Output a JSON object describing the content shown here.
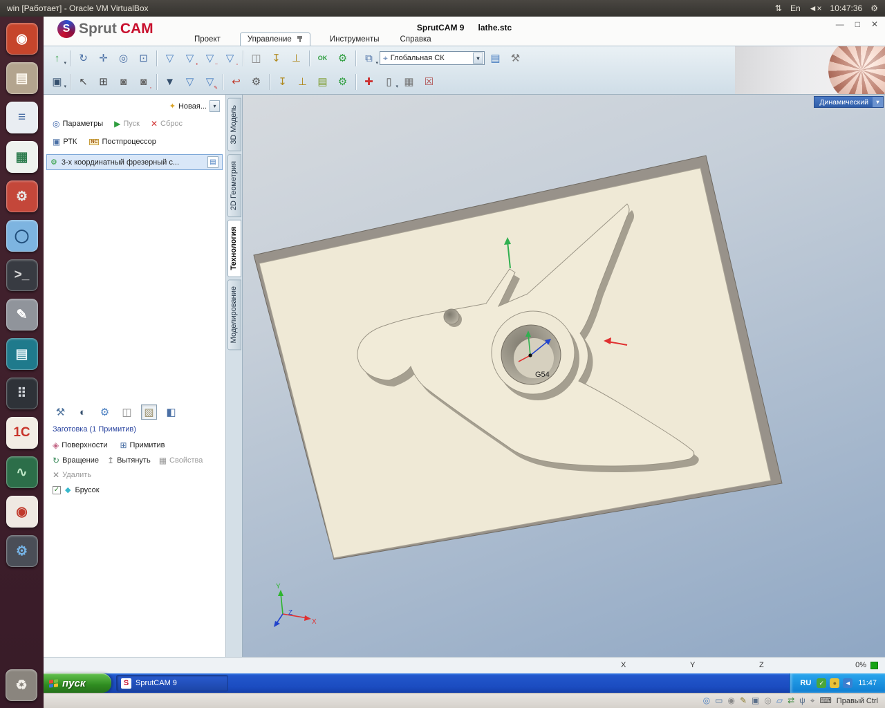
{
  "vbox": {
    "title": "win [Работает] - Oracle VM VirtualBox",
    "updown_icon": "⇅",
    "lang_indicator": "En",
    "mute_icon": "◄×",
    "clock": "10:47:36",
    "power_icon": "⚙",
    "host_key": "Правый Ctrl",
    "status_icons": [
      {
        "n": "zoom-status-icon",
        "g": "◎",
        "c": "#4a7fc1"
      },
      {
        "n": "screen-size-icon",
        "g": "▭",
        "c": "#4a6f9a"
      },
      {
        "n": "record-icon",
        "g": "◉",
        "c": "#888888"
      },
      {
        "n": "edit-icon",
        "g": "✎",
        "c": "#8a7a2a"
      },
      {
        "n": "hdd-icon",
        "g": "▣",
        "c": "#5a6f8a"
      },
      {
        "n": "cd-icon",
        "g": "◎",
        "c": "#888888"
      },
      {
        "n": "shared-folder-icon",
        "g": "▱",
        "c": "#4a7fc1"
      },
      {
        "n": "network-icon",
        "g": "⇄",
        "c": "#3c8a3c"
      },
      {
        "n": "usb-icon",
        "g": "ψ",
        "c": "#5a6f8a"
      },
      {
        "n": "mouse-integration-icon",
        "g": "⌖",
        "c": "#777777"
      },
      {
        "n": "keyboard-icon",
        "g": "⌨",
        "c": "#444444"
      }
    ]
  },
  "launcher": {
    "items": [
      {
        "n": "launcher-dash",
        "g": "◉",
        "bg": "#c6452c",
        "fg": "#ffffff"
      },
      {
        "n": "launcher-files",
        "g": "▤",
        "bg": "#b3a48e",
        "fg": "#fdf8ef"
      },
      {
        "n": "launcher-text-editor",
        "g": "≡",
        "bg": "#e9edf2",
        "fg": "#4a6fa5"
      },
      {
        "n": "launcher-spreadsheet",
        "g": "▦",
        "bg": "#eef2ee",
        "fg": "#2f7d4f"
      },
      {
        "n": "launcher-system-settings",
        "g": "⚙",
        "bg": "#c4473a",
        "fg": "#e8e8e8"
      },
      {
        "n": "launcher-browser",
        "g": "◯",
        "bg": "#7db4e0",
        "fg": "#1f4d7a"
      },
      {
        "n": "launcher-terminal",
        "g": ">_",
        "bg": "#383b42",
        "fg": "#d6d6d6"
      },
      {
        "n": "launcher-notes",
        "g": "✎",
        "bg": "#90949b",
        "fg": "#ffffff"
      },
      {
        "n": "launcher-docs",
        "g": "▤",
        "bg": "#1f7a8c",
        "fg": "#e2f2f6"
      },
      {
        "n": "launcher-calculator",
        "g": "⠿",
        "bg": "#2e3238",
        "fg": "#cfd3d8"
      },
      {
        "n": "launcher-1c",
        "g": "1С",
        "bg": "#f2ede4",
        "fg": "#c8342a"
      },
      {
        "n": "launcher-system-monitor",
        "g": "∿",
        "bg": "#2c6e49",
        "fg": "#bfe8c8"
      },
      {
        "n": "launcher-media",
        "g": "◉",
        "bg": "#efe9e2",
        "fg": "#c0392b"
      },
      {
        "n": "launcher-tweaks",
        "g": "⚙",
        "bg": "#4a4e57",
        "fg": "#76b5e8"
      }
    ],
    "trash": {
      "n": "launcher-trash",
      "g": "♻",
      "bg": "#8a857e",
      "fg": "#f2efe9"
    }
  },
  "app": {
    "logo_s": "S",
    "logo_sprut": "Sprut",
    "logo_cam": "CAM",
    "title": "SprutCAM 9",
    "file": "lathe.stc",
    "controls": {
      "minimize": "—",
      "restore": "□",
      "close": "✕"
    },
    "menus": [
      {
        "label": "Проект"
      },
      {
        "label": "Управление"
      },
      {
        "label": "Инструменты"
      },
      {
        "label": "Справка"
      }
    ]
  },
  "toolbar": {
    "cs_label": "Глобальная СК",
    "cs_icon": "⌖",
    "row1": [
      {
        "n": "open-model-button",
        "g": "↑",
        "c": "#2f9e3f",
        "dd": true
      },
      {
        "n": "sep"
      },
      {
        "n": "rotate-view-button",
        "g": "↻",
        "c": "#4a6fa5"
      },
      {
        "n": "pan-view-button",
        "g": "✛",
        "c": "#4a6fa5"
      },
      {
        "n": "zoom-view-button",
        "g": "◎",
        "c": "#4a6fa5"
      },
      {
        "n": "fit-view-button",
        "g": "⊡",
        "c": "#4a6fa5"
      },
      {
        "n": "sep"
      },
      {
        "n": "new-operation-button",
        "g": "▽",
        "c": "#4a7fc1"
      },
      {
        "n": "operation-point-button",
        "g": "▽",
        "c": "#4a7fc1",
        "b": "•"
      },
      {
        "n": "operation-curve-button",
        "g": "▽",
        "c": "#4a7fc1",
        "b": "~"
      },
      {
        "n": "operation-box-button",
        "g": "▽",
        "c": "#4a7fc1",
        "b": "▫"
      },
      {
        "n": "sep"
      },
      {
        "n": "stock-button",
        "g": "◫",
        "c": "#8a8a8a"
      },
      {
        "n": "tool-table-button",
        "g": "↧",
        "c": "#b08a20"
      },
      {
        "n": "tool-holder-button",
        "g": "⊥",
        "c": "#b08a20"
      },
      {
        "n": "sep"
      },
      {
        "n": "part-ok-button",
        "g": "OK",
        "c": "#2f9e3f"
      },
      {
        "n": "machine-setup-button",
        "g": "⚙",
        "c": "#2f9e3f"
      },
      {
        "n": "sep"
      },
      {
        "n": "layout-button",
        "g": "⧉",
        "c": "#4a6fa5",
        "dd": true
      },
      {
        "n": "cs-combo",
        "combo": true
      },
      {
        "n": "material-button",
        "g": "▤",
        "c": "#4a7fc1"
      },
      {
        "n": "hammer-button",
        "g": "⚒",
        "c": "#777777"
      }
    ],
    "row2": [
      {
        "n": "save-project-button",
        "g": "▣",
        "c": "#35506e",
        "dd": true
      },
      {
        "n": "sep"
      },
      {
        "n": "select-button",
        "g": "↖",
        "c": "#444444"
      },
      {
        "n": "box-select-button",
        "g": "⊞",
        "c": "#444444"
      },
      {
        "n": "capture-view-button",
        "g": "◙",
        "c": "#666666"
      },
      {
        "n": "capture-region-button",
        "g": "◙",
        "c": "#666666",
        "b": "▫"
      },
      {
        "n": "sep"
      },
      {
        "n": "funnel-active-button",
        "g": "▼",
        "c": "#35506e"
      },
      {
        "n": "funnel-button",
        "g": "▽",
        "c": "#4a7fc1"
      },
      {
        "n": "funnel-edit-button",
        "g": "▽",
        "c": "#4a7fc1",
        "b": "✎"
      },
      {
        "n": "sep"
      },
      {
        "n": "undo-button",
        "g": "↩",
        "c": "#c0392b"
      },
      {
        "n": "machine-gear-button",
        "g": "⚙",
        "c": "#555555"
      },
      {
        "n": "sep"
      },
      {
        "n": "spindle-button",
        "g": "↧",
        "c": "#b08a20"
      },
      {
        "n": "toolpath-button",
        "g": "⊥",
        "c": "#b08a20"
      },
      {
        "n": "gcode-button",
        "g": "▤",
        "c": "#7a9a2a"
      },
      {
        "n": "simulate-button",
        "g": "⚙",
        "c": "#2f9e3f"
      },
      {
        "n": "sep"
      },
      {
        "n": "transform-button",
        "g": "✚",
        "c": "#cc3333"
      },
      {
        "n": "new-doc-button",
        "g": "▯",
        "c": "#555555",
        "dd": true
      },
      {
        "n": "export-image-button",
        "g": "▦",
        "c": "#777777"
      },
      {
        "n": "delete-table-button",
        "g": "☒",
        "c": "#b05555"
      }
    ]
  },
  "panel": {
    "new_label": "Новая...",
    "new_icon": "✦",
    "params_label": "Параметры",
    "params_icon": "◎",
    "start_label": "Пуск",
    "start_icon": "▶",
    "reset_label": "Сброс",
    "reset_icon": "✕",
    "rtk_label": "РТК",
    "rtk_icon": "▣",
    "post_label": "Постпроцессор",
    "post_icon": "NC",
    "operation_label": "3-х координатный фрезерный с...",
    "operation_icon": "⚙",
    "operation_doc_icon": "▤",
    "workpiece_title": "Заготовка  (1 Примитив)",
    "tools": [
      {
        "n": "workpiece-machine-button",
        "g": "⚒",
        "c": "#4a6f9a"
      },
      {
        "n": "workpiece-shaded-button",
        "g": "◐",
        "c": "#35506e"
      },
      {
        "n": "workpiece-settings-button",
        "g": "⚙",
        "c": "#4a7fc1"
      },
      {
        "n": "workpiece-cylinder-button",
        "g": "◫",
        "c": "#8a8a8a"
      },
      {
        "n": "workpiece-box-button",
        "g": "▧",
        "c": "#9a8f6a",
        "sel": true
      },
      {
        "n": "workpiece-solid-button",
        "g": "◧",
        "c": "#4a6fa5"
      }
    ],
    "surfaces_label": "Поверхности",
    "surfaces_icon": "◈",
    "primitive_label": "Примитив",
    "primitive_icon": "⊞",
    "rotate_label": "Вращение",
    "rotate_icon": "↻",
    "extrude_label": "Вытянуть",
    "extrude_icon": "↥",
    "props_label": "Свойства",
    "props_icon": "▦",
    "delete_label": "Удалить",
    "delete_icon": "✕",
    "check_icon": "✓",
    "box_icon": "◆",
    "box_label": "Брусок"
  },
  "tabs": [
    {
      "label": "3D Модель"
    },
    {
      "label": "2D Геометрия"
    },
    {
      "label": "Технология",
      "active": true
    },
    {
      "label": "Моделирование"
    }
  ],
  "viewport": {
    "mode_label": "Динамический",
    "wcs_label": "G54",
    "axis_x": "X",
    "axis_y": "Y",
    "axis_z": "Z"
  },
  "status": {
    "x": "X",
    "y": "Y",
    "z": "Z",
    "progress": "0%"
  },
  "taskbar": {
    "start_label": "пуск",
    "task_label": "SprutCAM 9",
    "task_icon": "S",
    "lang": "RU",
    "clock": "11:47",
    "tray_icons": [
      {
        "n": "security-tray-icon",
        "g": "✓",
        "bg": "#4aa63c",
        "fg": "#ffffff"
      },
      {
        "n": "app-tray-icon",
        "g": "●",
        "bg": "#e8c23a",
        "fg": "#8a6a1a"
      },
      {
        "n": "volume-tray-icon",
        "g": "◄",
        "bg": "#3a7fd0",
        "fg": "#ffffff"
      }
    ]
  }
}
